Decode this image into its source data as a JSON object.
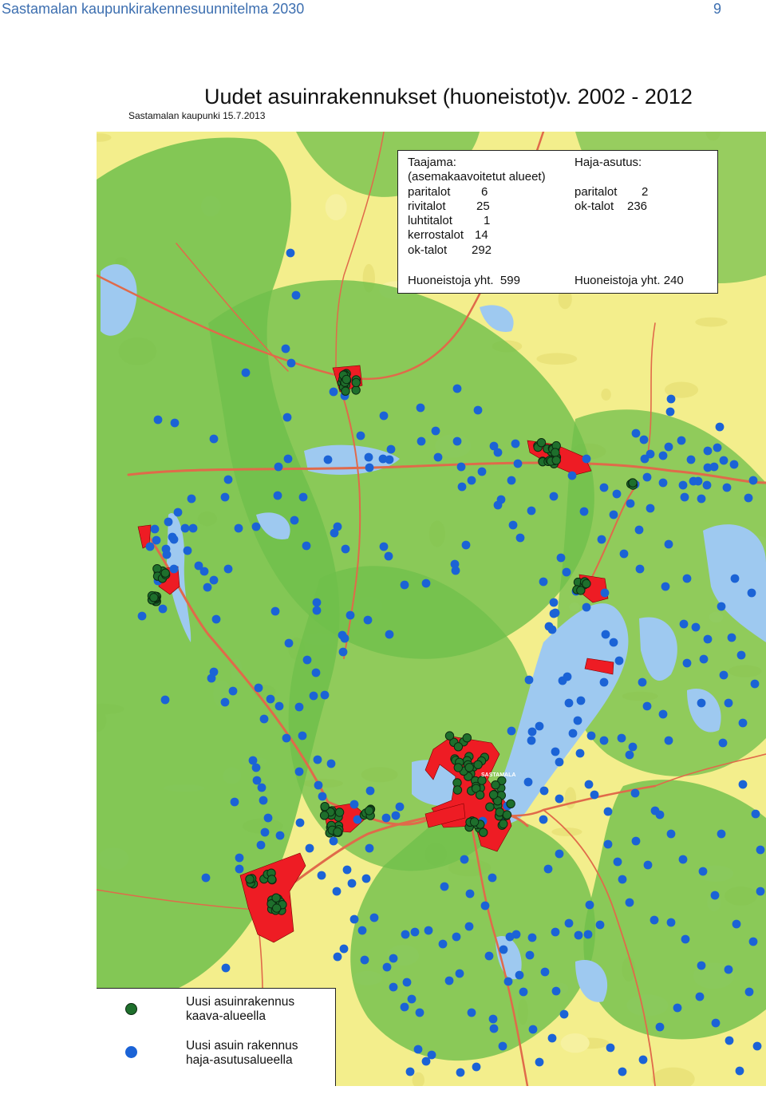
{
  "header": {
    "doc_title": "Sastamalan kaupunkirakennesuunnitelma 2030",
    "page_number": "9"
  },
  "map": {
    "title": "Uudet asuinrakennukset (huoneistot)v. 2002 - 2012",
    "credit": "Sastamalan kaupunki 15.7.2013",
    "place_label": "SASTAMALA",
    "colors": {
      "zoned_building_marker": "#1e6f2c",
      "rural_building_marker": "#1b63d6",
      "zoned_area": "#ee1c24",
      "forest": "#6fbf4b",
      "field": "#f3ee8c",
      "water": "#9ec9f0",
      "road": "#e06a4a"
    }
  },
  "stats": {
    "taajama": {
      "heading": "Taajama:",
      "subheading": "(asemakaavoitetut alueet)",
      "rows": [
        {
          "label": "paritalot",
          "value": "6"
        },
        {
          "label": "rivitalot",
          "value": "25"
        },
        {
          "label": "luhtitalot",
          "value": "1"
        },
        {
          "label": "kerrostalot",
          "value": "14"
        },
        {
          "label": "ok-talot",
          "value": "292"
        }
      ],
      "total_label": "Huoneistoja yht.",
      "total_value": "599"
    },
    "haja": {
      "heading": "Haja-asutus:",
      "rows": [
        {
          "label": "paritalot",
          "value": "2"
        },
        {
          "label": "ok-talot",
          "value": "236"
        }
      ],
      "total_label": "Huoneistoja yht.",
      "total_value": "240"
    }
  },
  "legend": {
    "items": [
      {
        "line1": "Uusi asuinrakennus",
        "line2": "kaava-alueella",
        "symbol": "green-dot"
      },
      {
        "line1": "Uusi asuin rakennus",
        "line2": "haja-asutusalueella",
        "symbol": "blue-dot"
      }
    ]
  }
}
